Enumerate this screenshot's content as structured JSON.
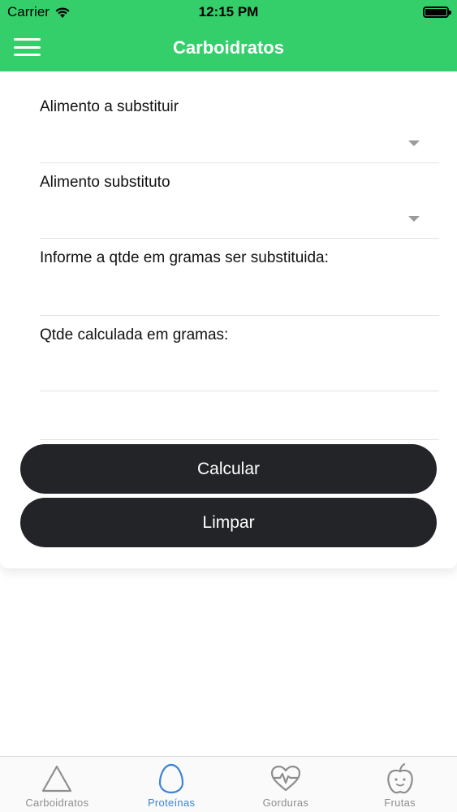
{
  "status_bar": {
    "carrier": "Carrier",
    "time": "12:15 PM"
  },
  "header": {
    "title": "Carboidratos",
    "menu_icon": "hamburger-menu-icon"
  },
  "form": {
    "food_to_replace_label": "Alimento a substituir",
    "food_to_replace_value": "",
    "substitute_food_label": "Alimento substituto",
    "substitute_food_value": "",
    "grams_input_label": "Informe a qtde em gramas ser substituida:",
    "grams_input_value": "",
    "calculated_label": "Qtde calculada em gramas:",
    "calculated_value": "",
    "extra_input_value": ""
  },
  "buttons": {
    "calculate_label": "Calcular",
    "clear_label": "Limpar"
  },
  "tab_bar": {
    "active_index": 1,
    "tabs": [
      {
        "label": "Carboidratos",
        "icon": "triangle-icon"
      },
      {
        "label": "Proteínas",
        "icon": "egg-icon"
      },
      {
        "label": "Gorduras",
        "icon": "heartbeat-icon"
      },
      {
        "label": "Frutas",
        "icon": "apple-icon"
      }
    ]
  },
  "colors": {
    "header_green": "#34cf6b",
    "button_dark": "#232427",
    "tab_active_blue": "#3d84d8",
    "tab_inactive_gray": "#8e8e8e"
  }
}
